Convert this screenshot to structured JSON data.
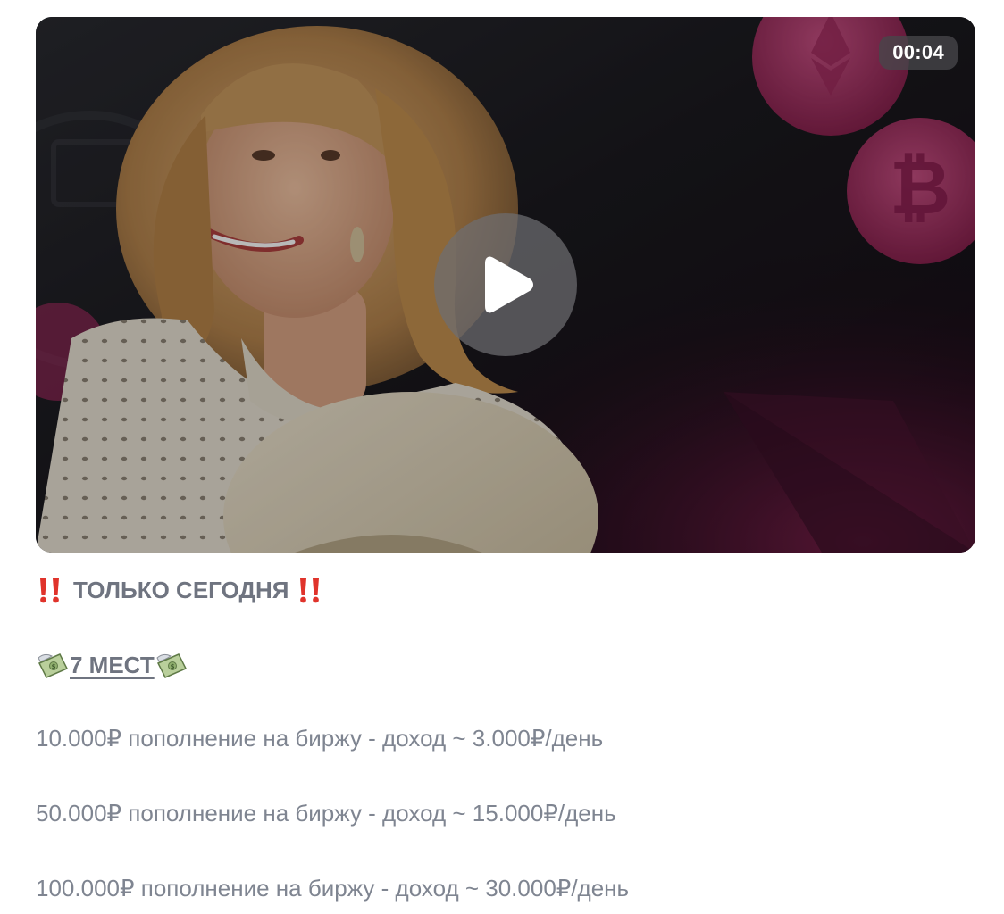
{
  "video": {
    "duration": "00:04",
    "play_icon": "play-icon",
    "colors": {
      "background": "#151218",
      "accent_coin": "#c53a73",
      "overlay": "#6e6e72"
    }
  },
  "post": {
    "headline": "ТОЛЬКО СЕГОДНЯ",
    "headline_icon": "double-exclamation-icon",
    "spots": "7 МЕСТ",
    "spots_icon": "money-with-wings-icon",
    "offers": [
      "10.000₽ пополнение на биржу - доход ~ 3.000₽/день",
      "50.000₽ пополнение на биржу - доход ~ 15.000₽/день",
      "100.000₽ пополнение на биржу - доход ~ 30.000₽/день"
    ]
  }
}
